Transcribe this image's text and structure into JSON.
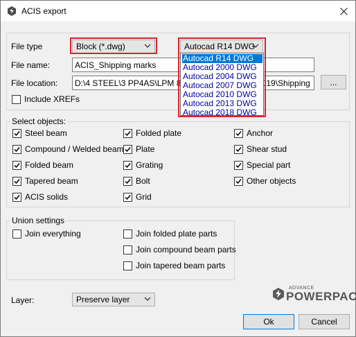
{
  "window": {
    "title": "ACIS export"
  },
  "file_type": {
    "label": "File type",
    "value": "Block (*.dwg)"
  },
  "version": {
    "value": "Autocad R14 DWG",
    "options": [
      "Autocad R14 DWG",
      "Autocad 2000 DWG",
      "Autocad 2004 DWG",
      "Autocad 2007 DWG",
      "Autocad 2010 DWG",
      "Autocad 2013 DWG",
      "Autocad 2018 DWG"
    ]
  },
  "file_name": {
    "label": "File name:",
    "value": "ACIS_Shipping marks"
  },
  "file_location": {
    "label": "File location:",
    "value": "D:\\4 STEEL\\3 PP4AS\\LPM 8.0",
    "value_tail": "2019\\Shipping",
    "browse": "..."
  },
  "include_xrefs": {
    "label": "Include XREFs",
    "checked": false
  },
  "select_objects": {
    "title": "Select objects:",
    "col1": [
      {
        "label": "Steel beam",
        "checked": true
      },
      {
        "label": "Compound / Welded beam",
        "checked": true
      },
      {
        "label": "Folded beam",
        "checked": true
      },
      {
        "label": "Tapered beam",
        "checked": true
      },
      {
        "label": "ACIS solids",
        "checked": true
      }
    ],
    "col2": [
      {
        "label": "Folded plate",
        "checked": true
      },
      {
        "label": "Plate",
        "checked": true
      },
      {
        "label": "Grating",
        "checked": true
      },
      {
        "label": "Bolt",
        "checked": true
      },
      {
        "label": "Grid",
        "checked": true
      }
    ],
    "col3": [
      {
        "label": "Anchor",
        "checked": true
      },
      {
        "label": "Shear stud",
        "checked": true
      },
      {
        "label": "Special part",
        "checked": true
      },
      {
        "label": "Other objects",
        "checked": true
      }
    ]
  },
  "union": {
    "title": "Union settings",
    "join_everything": "Join everything",
    "items": [
      "Join folded plate parts",
      "Join compound beam parts",
      "Join tapered beam parts"
    ]
  },
  "layer": {
    "label": "Layer:",
    "value": "Preserve layer"
  },
  "logo": {
    "small": "ADVANCE",
    "big": "POWERPACK"
  },
  "buttons": {
    "ok": "Ok",
    "cancel": "Cancel"
  },
  "colors": {
    "highlight": "#d7262d",
    "selection": "#0078d7"
  }
}
